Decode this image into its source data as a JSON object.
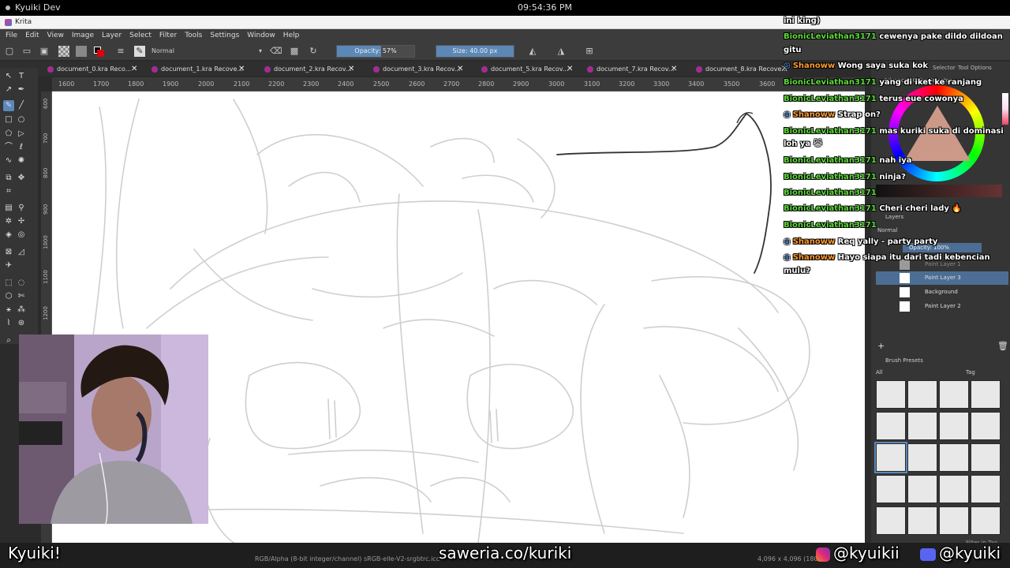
{
  "obs": {
    "window_title": "Kyuiki Dev",
    "clock": "09:54:36 PM"
  },
  "app": {
    "title": "Krita"
  },
  "menu": [
    "File",
    "Edit",
    "View",
    "Image",
    "Layer",
    "Select",
    "Filter",
    "Tools",
    "Settings",
    "Window",
    "Help"
  ],
  "toolbar": {
    "blend_mode": "Normal",
    "opacity_label": "Opacity: 57%",
    "opacity_value": 0.57,
    "size_label": "Size: 40.00 px"
  },
  "tabs": [
    {
      "label": "document_0.kra Reco..."
    },
    {
      "label": "document_1.kra Recove..."
    },
    {
      "label": "document_2.kra Recov..."
    },
    {
      "label": "document_3.kra Recov..."
    },
    {
      "label": "document_5.kra Recov..."
    },
    {
      "label": "document_7.kra Recov..."
    },
    {
      "label": "document_8.kra Recove..."
    }
  ],
  "ruler": {
    "h": [
      "1600",
      "1700",
      "1800",
      "1900",
      "2000",
      "2100",
      "2200",
      "2300",
      "2400",
      "2500",
      "2600",
      "2700",
      "2800",
      "2900",
      "3000",
      "3100",
      "3200",
      "3300",
      "3400",
      "3500",
      "3600"
    ],
    "v": [
      "600",
      "700",
      "800",
      "900",
      "1000",
      "1100",
      "1200"
    ]
  },
  "docker": {
    "selector_tab": "Selector",
    "tool_options_tab": "Tool Options",
    "advanced_color_selector": "Advanced Color Selector",
    "layers_title": "Layers",
    "layers_blend": "Normal",
    "layers_opacity": "Opacity: 100%",
    "layers": [
      {
        "name": "Paint Layer 1"
      },
      {
        "name": "Paint Layer 3"
      },
      {
        "name": "Background"
      },
      {
        "name": "Paint Layer 2"
      }
    ],
    "brush_presets_title": "Brush Presets",
    "brush_filter": "All",
    "tag_label": "Tag",
    "filter_in_tag": "Filter in Tag"
  },
  "chat": [
    {
      "user": "",
      "text": "ini king)",
      "color": "green"
    },
    {
      "user": "BionicLeviathan3171",
      "text": "cewenya pake dildo dildoan",
      "color": "green"
    },
    {
      "user": "",
      "text": "gitu",
      "color": "green"
    },
    {
      "user": "Shanoww",
      "text": "Wong saya suka kok",
      "color": "orange"
    },
    {
      "user": "BionicLeviathan3171",
      "text": "yang di iket ke ranjang",
      "color": "green"
    },
    {
      "user": "BionicLeviathan3171",
      "text": "terus eue cowonya",
      "color": "green"
    },
    {
      "user": "Shanoww",
      "text": "Strap on?",
      "color": "orange"
    },
    {
      "user": "BionicLeviathan3171",
      "text": "mas kuriki suka di dominasi",
      "color": "green"
    },
    {
      "user": "",
      "text": "loh ya 😹",
      "color": "green"
    },
    {
      "user": "BionicLeviathan3171",
      "text": "nah iya",
      "color": "green"
    },
    {
      "user": "BionicLeviathan3171",
      "text": "ninja?",
      "color": "green"
    },
    {
      "user": "BionicLeviathan3171",
      "text": "",
      "color": "green"
    },
    {
      "user": "BionicLeviathan3171",
      "text": "Cheri cheri lady 🔥",
      "color": "green"
    },
    {
      "user": "BionicLeviathan3171",
      "text": "",
      "color": "green"
    },
    {
      "user": "Shanoww",
      "text": "Req yally - party party",
      "color": "orange"
    },
    {
      "user": "Shanoww",
      "text": "Hayo siapa itu dari tadi kebencian",
      "color": "orange"
    },
    {
      "user": "",
      "text": "mulu?",
      "color": "orange"
    }
  ],
  "statusbar": {
    "colorspace": "RGB/Alpha (8-bit integer/channel)  sRGB-elle-V2-srgbtrc.icc",
    "dims": "4,096 x 4,096 (180..."
  },
  "overlay": {
    "name": "Kyuiki!",
    "saweria": "saweria.co/kuriki",
    "instagram": "@kyuikii",
    "discord": "@kyuiki"
  }
}
